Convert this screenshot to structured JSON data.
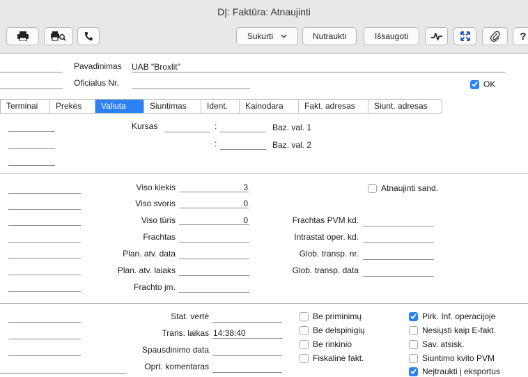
{
  "window": {
    "title": "DĮ: Faktūra: Atnaujinti"
  },
  "toolbar": {
    "print_icon": "printer-icon",
    "preview_icon": "print-preview-icon",
    "phone_icon": "phone-icon",
    "create_label": "Sukurti",
    "cancel_label": "Nutraukti",
    "save_label": "Išsaugoti",
    "activity_icon": "pulse-icon",
    "expand_icon": "expand-icon",
    "attach_icon": "paperclip-icon",
    "help_label": "?"
  },
  "header": {
    "name_label": "Pavadinimas",
    "name_value": "UAB \"Broxlit\"",
    "official_label": "Oficialus Nr.",
    "official_value": "",
    "ok_label": "OK",
    "ok_checked": true
  },
  "tabs": [
    {
      "label": "Terminai",
      "active": false
    },
    {
      "label": "Prekės",
      "active": false
    },
    {
      "label": "Valiuta",
      "active": true
    },
    {
      "label": "Siuntimas",
      "active": false
    },
    {
      "label": "Ident.",
      "active": false
    },
    {
      "label": "Kainodara",
      "active": false
    },
    {
      "label": "Fakt. adresas",
      "active": false
    },
    {
      "label": "Siunt. adresas",
      "active": false
    }
  ],
  "currency": {
    "rate_label": "Kursas",
    "colon": ":",
    "base1_label": "Baz. val. 1",
    "base2_label": "Baz. val. 2"
  },
  "shipping": {
    "total_qty_label": "Viso kiekis",
    "total_qty_value": "3",
    "total_weight_label": "Viso svoris",
    "total_weight_value": "0",
    "total_volume_label": "Viso tūris",
    "total_volume_value": "0",
    "freight_label": "Frachtas",
    "plan_date_label": "Plan. atv. data",
    "plan_time_label": "Plan. atv. laiaks",
    "freight_unit_label": "Frachto jm.",
    "update_contracts_label": "Atnaujinti sand.",
    "update_contracts_checked": false,
    "freight_vat_label": "Frachtas PVM kd.",
    "intrastat_label": "Intrastat oper. kd.",
    "glob_transp_nr_label": "Glob. transp. nr.",
    "glob_transp_date_label": "Glob. transp. data"
  },
  "bottom": {
    "stat_value_label": "Stat. vertė",
    "trans_time_label": "Trans. laikas",
    "trans_time_value": "14:38:40",
    "print_date_label": "Spausdinimo data",
    "oper_comment_label": "Oprt. komentaras",
    "checks_mid": [
      {
        "label": "Be priminimų",
        "checked": false
      },
      {
        "label": "Be delspinigių",
        "checked": false
      },
      {
        "label": "Be rinkinio",
        "checked": false
      },
      {
        "label": "Fiskalinė fakt.",
        "checked": false
      }
    ],
    "checks_right": [
      {
        "label": "Pirk. Inf. operacijoje",
        "checked": true
      },
      {
        "label": "Nesiųsti kaip E-fakt.",
        "checked": false
      },
      {
        "label": "Sav. atsisk.",
        "checked": false
      },
      {
        "label": "Siuntimo kvito PVM",
        "checked": false
      },
      {
        "label": "Neįtraukti į eksportus",
        "checked": true
      }
    ]
  },
  "colors": {
    "accent": "#2c82f4",
    "chrome": "#e8e8e8"
  }
}
